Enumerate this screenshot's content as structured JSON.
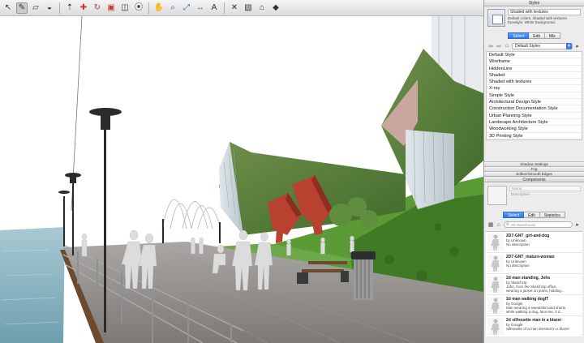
{
  "toolbar": {
    "tools": [
      {
        "icon": "select-arrow-icon",
        "glyph": "↖",
        "active": false
      },
      {
        "icon": "pencil-icon",
        "glyph": "✎",
        "active": true
      },
      {
        "icon": "eraser-icon",
        "glyph": "▱",
        "active": false
      },
      {
        "icon": "paint-bucket-icon",
        "glyph": "◒",
        "active": false
      },
      {
        "icon": "push-pull-icon",
        "glyph": "⇡",
        "active": false
      },
      {
        "icon": "move-icon",
        "glyph": "✚",
        "active": false
      },
      {
        "icon": "rotate-icon",
        "glyph": "↻",
        "active": false
      },
      {
        "icon": "scale-icon",
        "glyph": "▣",
        "active": false
      },
      {
        "icon": "offset-icon",
        "glyph": "◫",
        "active": false
      },
      {
        "icon": "orbit-icon",
        "glyph": "⦿",
        "active": false
      },
      {
        "icon": "pan-icon",
        "glyph": "✋",
        "active": false
      },
      {
        "icon": "zoom-icon",
        "glyph": "⌕",
        "active": false
      },
      {
        "icon": "zoom-extents-icon",
        "glyph": "⤢",
        "active": false
      },
      {
        "icon": "tape-measure-icon",
        "glyph": "↔",
        "active": false
      },
      {
        "icon": "text-icon",
        "glyph": "A",
        "active": false
      },
      {
        "icon": "axes-icon",
        "glyph": "✕",
        "active": false
      },
      {
        "icon": "section-plane-icon",
        "glyph": "▧",
        "active": false
      },
      {
        "icon": "3d-warehouse-icon",
        "glyph": "⌂",
        "active": false
      },
      {
        "icon": "extension-warehouse-icon",
        "glyph": "◆",
        "active": false
      }
    ]
  },
  "styles_panel": {
    "title": "Styles",
    "current_style": {
      "name": "Shaded with textures",
      "description": "Default colors, shaded with textures facestyle. White background."
    },
    "tabs": [
      "Select",
      "Edit",
      "Mix"
    ],
    "active_tab": 0,
    "collection": "Default Styles",
    "styles": [
      "Default Style",
      "Wireframe",
      "HiddenLine",
      "Shaded",
      "Shaded with textures",
      "X-ray",
      "Simple Style",
      "Architectural Design Style",
      "Construction Documentation Style",
      "Urban Planning Style",
      "Landscape Architecture Style",
      "Woodworking Style",
      "3D Printing Style"
    ]
  },
  "collapsed_panels": [
    "Shadow Settings",
    "Fog",
    "Soften/Smooth Edges"
  ],
  "components_panel": {
    "title": "Components",
    "preview": {
      "name_placeholder": "Name",
      "description_placeholder": "Description"
    },
    "tabs": [
      "Select",
      "Edit",
      "Statistics"
    ],
    "active_tab": 0,
    "search_placeholder": "3D Warehouse",
    "items": [
      {
        "title": "2D7-GNT_girl-and-dog",
        "line1": "by Unknown",
        "line2": "No description"
      },
      {
        "title": "2D7-GNT_mature-woman",
        "line1": "by Unknown",
        "line2": "No description"
      },
      {
        "title": "2d man standing, Johs",
        "line1": "by SketchUp",
        "line2": "John, from the SketchUp office,",
        "line3": "wearing a jacket on jeans, holding..."
      },
      {
        "title": "2d man walking dogIT",
        "line1": "by Google",
        "line2": "Man wearing a sweatshirt and shorts",
        "line3": "while walking a dog, face-me, 2 d..."
      },
      {
        "title": "2d silhouette man in a blazer",
        "line1": "by Google",
        "line2": "Silhouette of a man dressed in a blazer"
      }
    ]
  },
  "colors": {
    "accent": "#2f78e0",
    "sky": "#ffffff",
    "water": "#8fb8c6",
    "grass": "#4f8f2e",
    "red_sculpture": "#b8412f",
    "boardwalk": "#8e8a86"
  }
}
